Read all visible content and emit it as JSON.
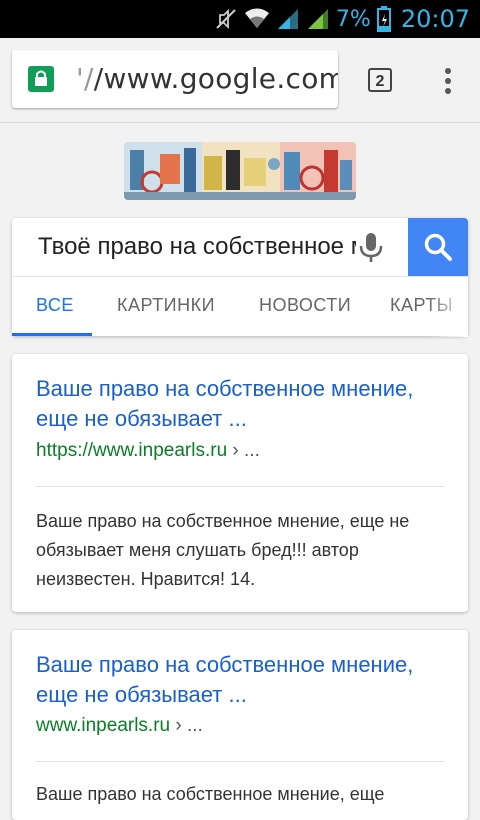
{
  "status_bar": {
    "battery": "7%",
    "time": "20:07"
  },
  "browser": {
    "url_prefix": "'/",
    "url_main": "/www.google.com/s",
    "tab_count": "2"
  },
  "search": {
    "query": "Твоё право на собственное мнение",
    "tabs": [
      {
        "label": "ВСЕ",
        "active": true
      },
      {
        "label": "КАРТИНКИ",
        "active": false
      },
      {
        "label": "НОВОСТИ",
        "active": false
      },
      {
        "label": "КАРТЫ",
        "active": false
      }
    ]
  },
  "results": [
    {
      "title": "Ваше право на собственное мнение, еще не обязывает ...",
      "url_main": "https://www.inpearls.ru",
      "url_rest": " › ...",
      "snippet": "Ваше право на собственное мнение, еще не обязывает меня слушать бред!!! автор неизвестен. Нравится! 14."
    },
    {
      "title": "Ваше право на собственное мнение, еще не обязывает ...",
      "url_main": "www.inpearls.ru",
      "url_rest": " › ...",
      "snippet": "Ваше право на собственное мнение, еще"
    }
  ],
  "colors": {
    "accent": "#4285f4",
    "link": "#1a5fcf",
    "url_green": "#0b7d26",
    "status_blue": "#33b5e5"
  }
}
